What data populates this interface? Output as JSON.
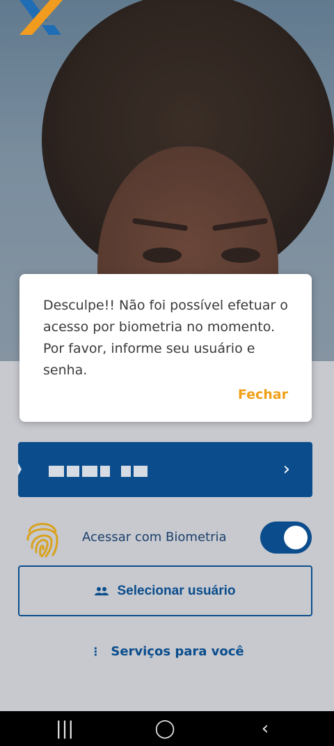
{
  "dialog": {
    "message": "Desculpe!! Não foi possível efetuar o acesso por biometria no momento. Por favor, informe seu usuário e senha.",
    "close_label": "Fechar"
  },
  "login": {
    "user_chevron": "›",
    "biometric_label": "Acessar com Biometria",
    "biometric_enabled": true,
    "select_user_label": "Selecionar usuário",
    "services_label": "Serviços para você",
    "services_icon": "⋮"
  },
  "colors": {
    "primary": "#0b4d8c",
    "accent": "#f0a018",
    "logo_blue": "#1f6db5",
    "logo_orange": "#f29c1f"
  },
  "icons": {
    "logo": "caixa-logo",
    "fingerprint": "fingerprint-icon",
    "users": "users-icon",
    "more": "more-vertical-icon"
  },
  "system_nav": {
    "recents": "|||",
    "home": "◯",
    "back": "‹"
  }
}
